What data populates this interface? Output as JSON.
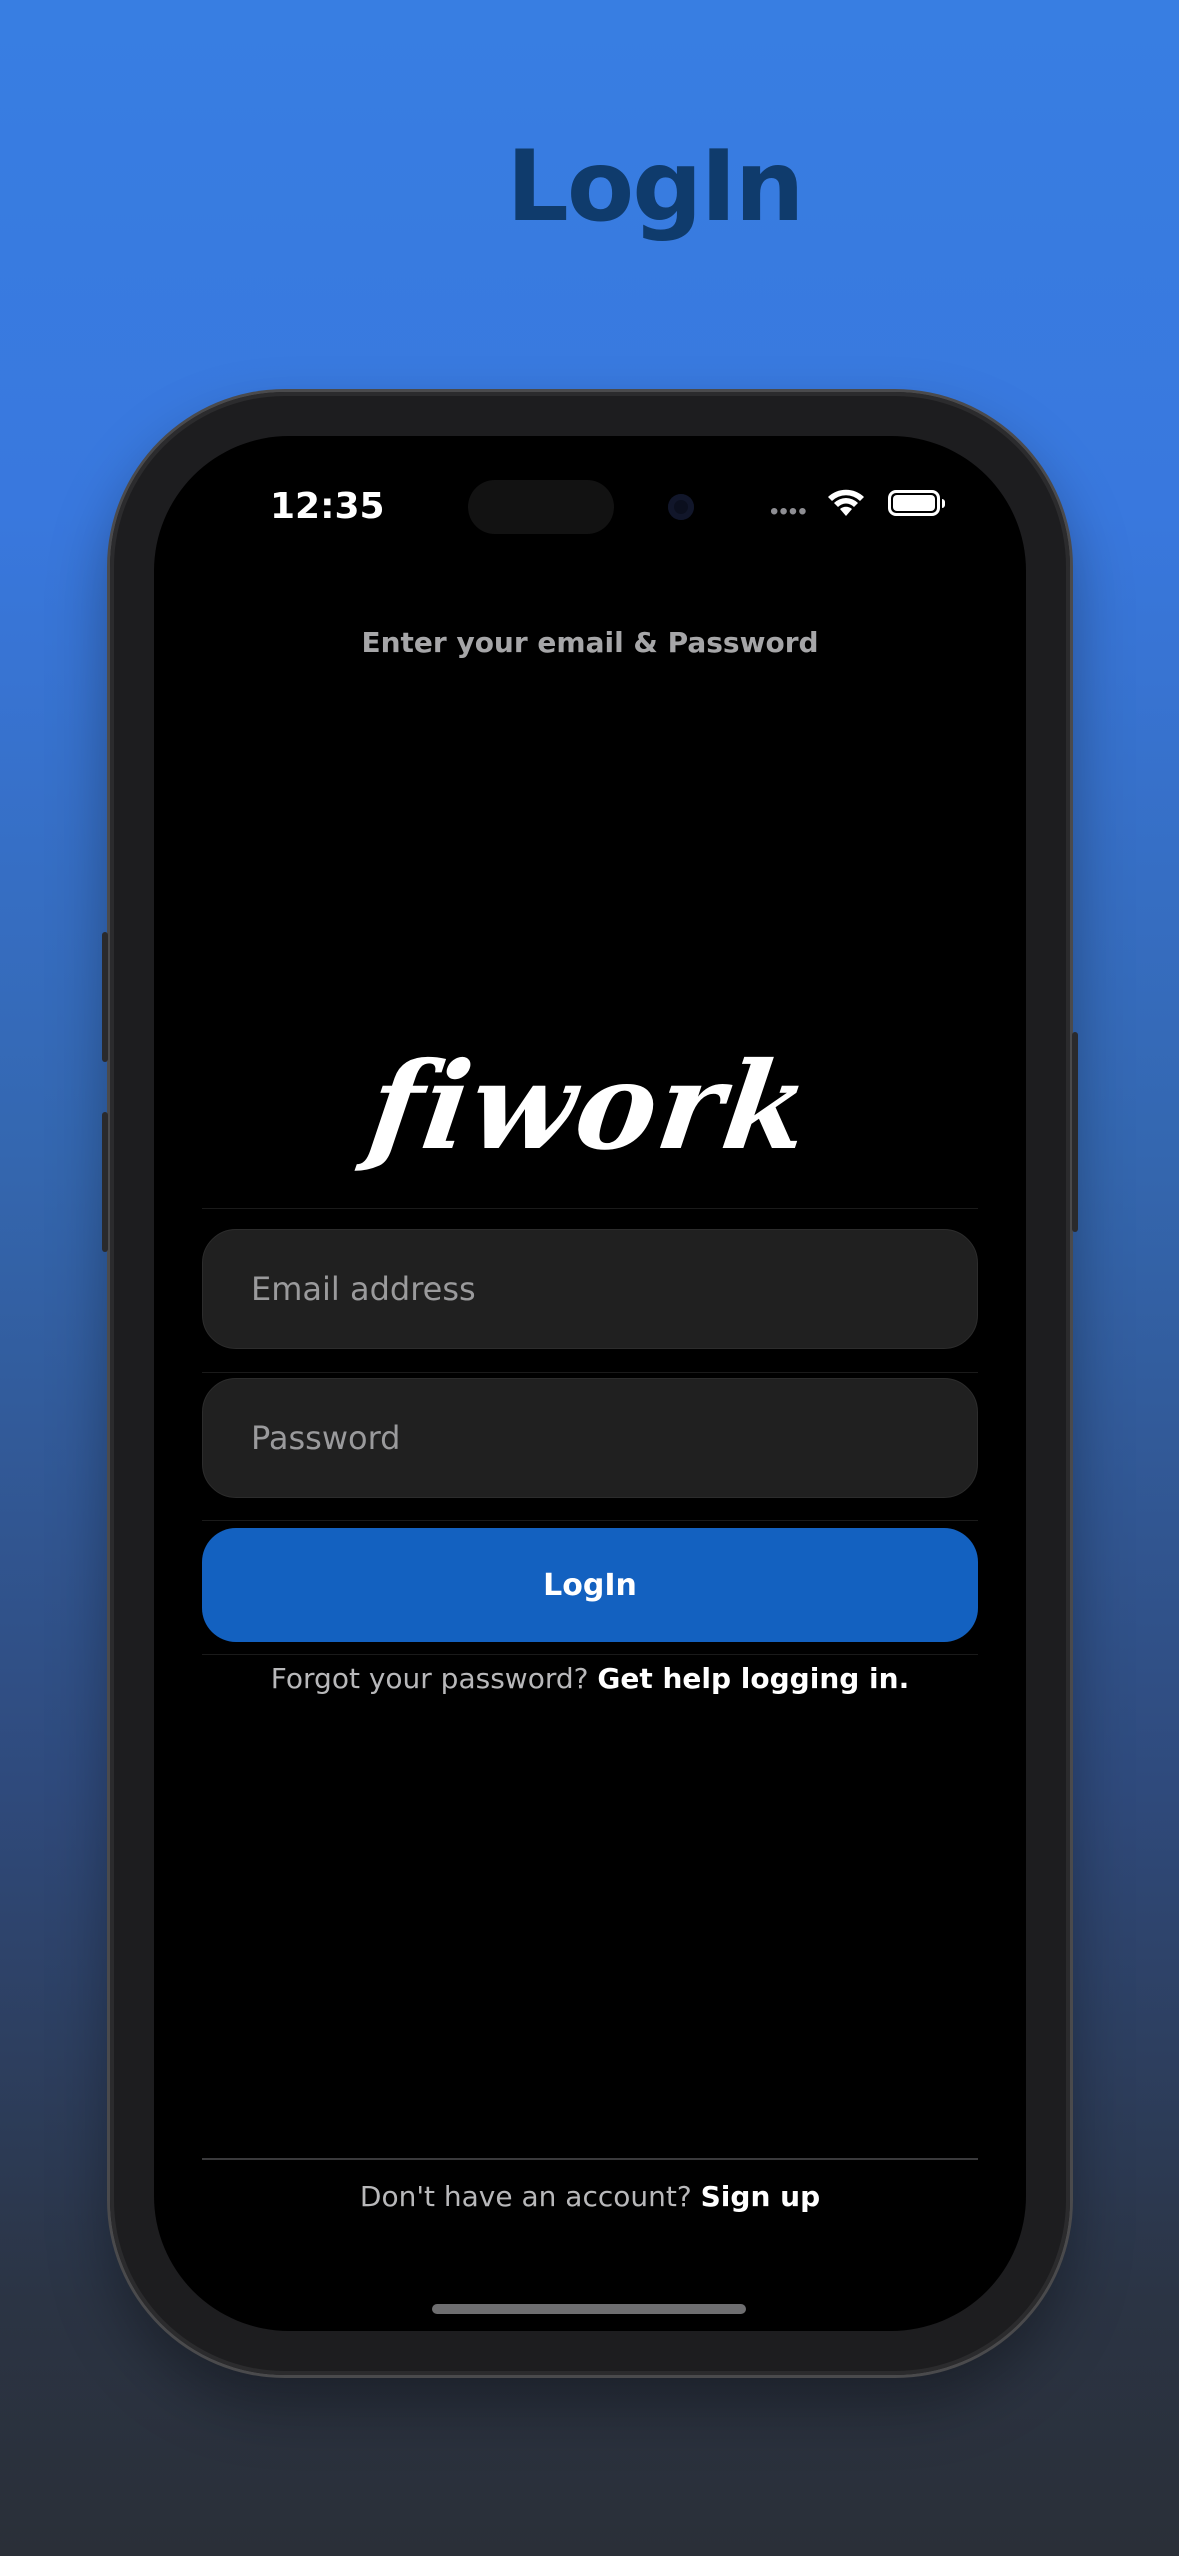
{
  "header": {
    "title": "LogIn"
  },
  "status_bar": {
    "time": "12:35",
    "signal_icon": "signal-dots-icon",
    "wifi_icon": "wifi-icon",
    "battery_icon": "battery-icon"
  },
  "login": {
    "subtitle": "Enter your email & Password",
    "logo_text": "fiwork",
    "email_placeholder": "Email address",
    "password_placeholder": "Password",
    "login_button": "LogIn",
    "forgot_prefix": "Forgot your password?",
    "forgot_link": "Get help logging in.",
    "signup_prefix": "Don't have an account?",
    "signup_link": "Sign up"
  },
  "colors": {
    "accent": "#1361c0",
    "title": "#0f3b6c",
    "field_bg": "#202020"
  }
}
